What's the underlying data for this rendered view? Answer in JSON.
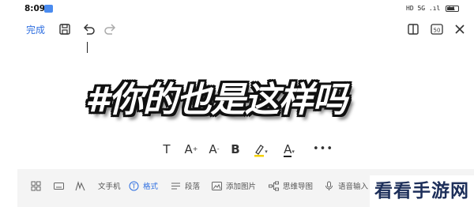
{
  "status_bar": {
    "time": "8:09",
    "indicators": "HD 5G .ıl .ıl",
    "battery_icon": "battery-icon"
  },
  "toolbar": {
    "done_label": "完成",
    "icons": [
      "save-icon",
      "undo-icon",
      "redo-icon",
      "split-view-icon",
      "word-count-icon",
      "close-icon"
    ],
    "word_count_label": "50"
  },
  "document": {
    "headline": "#你的也是这样吗"
  },
  "format_popup": {
    "buttons": [
      "T",
      "A",
      "A",
      "B",
      "highlighter-icon",
      "A",
      "more-icon"
    ],
    "increase_sup": "+",
    "decrease_sup": "-",
    "highlight_color": "#f5d100",
    "text_color": "#222222"
  },
  "bottom_bar": {
    "items": [
      {
        "icon": "grid-icon",
        "label": ""
      },
      {
        "icon": "keyboard-icon",
        "label": ""
      },
      {
        "icon": "handwriting-icon",
        "label": ""
      },
      {
        "icon": "",
        "label": "文手机"
      },
      {
        "icon": "format-icon",
        "label": "格式"
      },
      {
        "icon": "paragraph-icon",
        "label": "段落"
      },
      {
        "icon": "image-icon",
        "label": "添加图片"
      },
      {
        "icon": "mindmap-icon",
        "label": "思维导图"
      },
      {
        "icon": "mic-icon",
        "label": "语音输入"
      },
      {
        "icon": "scan-icon",
        "label": ""
      }
    ],
    "active_color": "#2f6fe0"
  },
  "watermark": {
    "text": "看看手游网"
  }
}
